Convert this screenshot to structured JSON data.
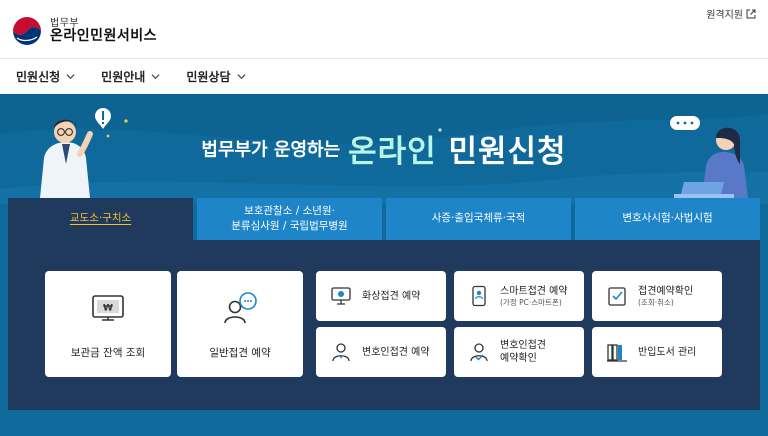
{
  "header": {
    "logo_sub": "법무부",
    "logo_main": "온라인민원서비스",
    "remote_support": "원격지원"
  },
  "nav": {
    "items": [
      {
        "label": "민원신청"
      },
      {
        "label": "민원안내"
      },
      {
        "label": "민원상담"
      }
    ]
  },
  "banner": {
    "title_small": "법무부가 운영하는",
    "title_big_a": "온라인",
    "title_big_b": "민원신청"
  },
  "tabs": [
    {
      "label": "교도소·구치소",
      "active": true
    },
    {
      "label": "보호관찰소 / 소년원·\n분류심사원 / 국립법무병원",
      "active": false
    },
    {
      "label": "사증·출입국체류·국적",
      "active": false
    },
    {
      "label": "변호사시험·사법시험",
      "active": false
    }
  ],
  "cards": {
    "balance": {
      "label": "보관금 잔액 조회"
    },
    "general_visit": {
      "label": "일반접견 예약"
    },
    "video_visit": {
      "label": "화상접견 예약"
    },
    "smart_visit": {
      "label": "스마트접견 예약",
      "sub": "(가정 PC·스마트폰)"
    },
    "visit_confirm": {
      "label": "접견예약확인",
      "sub": "(조회·취소)"
    },
    "lawyer_visit": {
      "label": "변호인접견 예약"
    },
    "lawyer_confirm": {
      "label": "변호인접견\n예약확인"
    },
    "books": {
      "label": "반입도서 관리"
    }
  },
  "colors": {
    "banner_bg": "#0f6a9b",
    "panel_bg": "#203a5d",
    "tab_bg": "#1e86c8",
    "active_tab_text": "#f2c232",
    "highlight": "#b9f5e4"
  }
}
